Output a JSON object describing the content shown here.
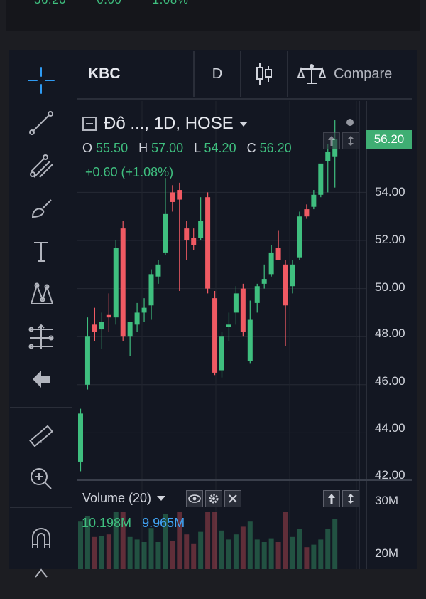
{
  "top_values": [
    "56.20",
    "0.00",
    "1.08%"
  ],
  "header": {
    "symbol": "KBC",
    "interval": "D",
    "compare": "Compare"
  },
  "legend": {
    "title": "Đô ..., 1D, HOSE",
    "o_label": "O",
    "o_value": "55.50",
    "h_label": "H",
    "h_value": "57.00",
    "l_label": "L",
    "l_value": "54.20",
    "c_label": "C",
    "c_value": "56.20",
    "change": "+0.60 (+1.08%)"
  },
  "price_axis": [
    "54.00",
    "52.00",
    "50.00",
    "48.00",
    "46.00",
    "44.00",
    "42.00"
  ],
  "last_price": "56.20",
  "volume": {
    "title": "Volume (20)",
    "value1": "10.198M",
    "value2": "9.965M",
    "axis": [
      "30M",
      "20M"
    ]
  },
  "colors": {
    "up": "#3fbf7f",
    "down": "#f05a63",
    "accent": "#3fae73",
    "blue": "#42a5f5"
  },
  "chart_data": {
    "type": "candlestick",
    "ylim": [
      42,
      57.8
    ],
    "candles": [
      {
        "o": 42.8,
        "h": 45.0,
        "l": 42.4,
        "c": 44.8
      },
      {
        "o": 46.0,
        "h": 48.8,
        "l": 45.8,
        "c": 48.0
      },
      {
        "o": 48.5,
        "h": 49.2,
        "l": 47.8,
        "c": 48.2
      },
      {
        "o": 48.3,
        "h": 49.0,
        "l": 47.5,
        "c": 48.6
      },
      {
        "o": 48.9,
        "h": 49.8,
        "l": 48.2,
        "c": 48.8
      },
      {
        "o": 48.8,
        "h": 52.0,
        "l": 48.5,
        "c": 51.7
      },
      {
        "o": 52.5,
        "h": 52.8,
        "l": 47.8,
        "c": 48.0
      },
      {
        "o": 48.0,
        "h": 48.6,
        "l": 47.2,
        "c": 48.6
      },
      {
        "o": 48.5,
        "h": 49.4,
        "l": 48.2,
        "c": 49.0
      },
      {
        "o": 49.0,
        "h": 49.6,
        "l": 48.6,
        "c": 49.2
      },
      {
        "o": 49.3,
        "h": 50.8,
        "l": 48.7,
        "c": 50.6
      },
      {
        "o": 50.5,
        "h": 51.2,
        "l": 50.2,
        "c": 51.0
      },
      {
        "o": 51.5,
        "h": 54.6,
        "l": 51.4,
        "c": 53.1
      },
      {
        "o": 54.0,
        "h": 54.3,
        "l": 53.2,
        "c": 53.6
      },
      {
        "o": 54.1,
        "h": 54.4,
        "l": 49.9,
        "c": 53.7
      },
      {
        "o": 52.5,
        "h": 52.8,
        "l": 51.2,
        "c": 52.0
      },
      {
        "o": 52.1,
        "h": 52.5,
        "l": 51.6,
        "c": 51.8
      },
      {
        "o": 52.1,
        "h": 53.8,
        "l": 52.0,
        "c": 52.8
      },
      {
        "o": 53.8,
        "h": 54.0,
        "l": 49.8,
        "c": 50.0
      },
      {
        "o": 49.6,
        "h": 49.9,
        "l": 46.4,
        "c": 46.5
      },
      {
        "o": 46.6,
        "h": 48.2,
        "l": 46.3,
        "c": 48.0
      },
      {
        "o": 48.4,
        "h": 49.0,
        "l": 47.8,
        "c": 48.5
      },
      {
        "o": 49.0,
        "h": 50.1,
        "l": 48.5,
        "c": 49.8
      },
      {
        "o": 50.0,
        "h": 50.2,
        "l": 48.0,
        "c": 48.2
      },
      {
        "o": 47.0,
        "h": 49.5,
        "l": 46.9,
        "c": 48.7
      },
      {
        "o": 49.4,
        "h": 50.2,
        "l": 49.0,
        "c": 50.1
      },
      {
        "o": 50.2,
        "h": 51.0,
        "l": 50.0,
        "c": 50.4
      },
      {
        "o": 50.6,
        "h": 51.8,
        "l": 50.5,
        "c": 51.5
      },
      {
        "o": 51.7,
        "h": 52.4,
        "l": 51.4,
        "c": 51.2
      },
      {
        "o": 51.0,
        "h": 51.2,
        "l": 47.6,
        "c": 49.3
      },
      {
        "o": 50.1,
        "h": 51.2,
        "l": 49.8,
        "c": 51.0
      },
      {
        "o": 51.3,
        "h": 53.2,
        "l": 51.2,
        "c": 53.0
      },
      {
        "o": 53.3,
        "h": 53.5,
        "l": 52.9,
        "c": 53.0
      },
      {
        "o": 53.4,
        "h": 54.1,
        "l": 53.3,
        "c": 53.9
      },
      {
        "o": 53.9,
        "h": 55.0,
        "l": 53.8,
        "c": 55.2
      },
      {
        "o": 55.3,
        "h": 56.0,
        "l": 54.0,
        "c": 55.7
      },
      {
        "o": 55.5,
        "h": 57.0,
        "l": 54.2,
        "c": 56.2
      }
    ]
  }
}
